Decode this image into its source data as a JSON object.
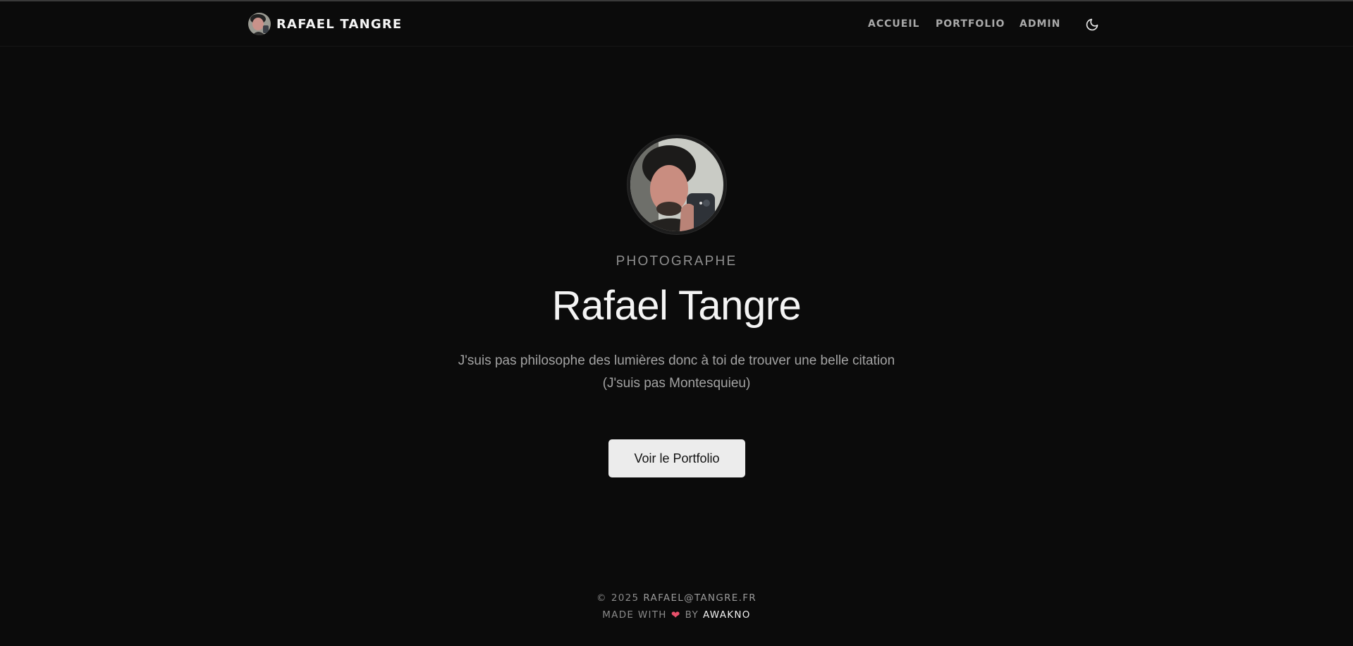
{
  "navbar": {
    "brand_name": "RAFAEL TANGRE",
    "links": [
      {
        "label": "ACCUEIL"
      },
      {
        "label": "PORTFOLIO"
      },
      {
        "label": "ADMIN"
      }
    ],
    "theme_icon": "moon-icon"
  },
  "hero": {
    "kicker": "PHOTOGRAPHE",
    "name": "Rafael Tangre",
    "tagline_line1": "J'suis pas philosophe des lumières donc à toi de trouver une belle citation",
    "tagline_line2": "(J'suis pas Montesquieu)",
    "cta_label": "Voir le Portfolio"
  },
  "footer": {
    "copyright_symbol": "©",
    "year": "2025",
    "email": "RAFAEL@TANGRE.FR",
    "made_with": "MADE WITH",
    "heart_icon": "heart-icon",
    "by": "BY",
    "credit": "AWAKNO"
  },
  "colors": {
    "background": "#0b0b0b",
    "accent_heart": "#e8506a",
    "button_bg": "#ececec"
  }
}
